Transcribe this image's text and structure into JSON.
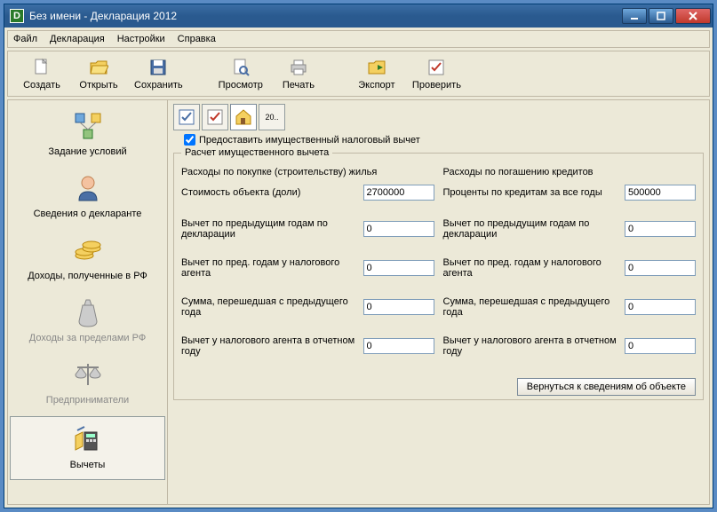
{
  "window": {
    "title": "Без имени - Декларация 2012",
    "app_icon_letter": "D"
  },
  "menu": {
    "file": "Файл",
    "declaration": "Декларация",
    "settings": "Настройки",
    "help": "Справка"
  },
  "toolbar": {
    "create": "Создать",
    "open": "Открыть",
    "save": "Сохранить",
    "preview": "Просмотр",
    "print": "Печать",
    "export": "Экспорт",
    "check": "Проверить"
  },
  "sidebar": {
    "items": [
      {
        "label": "Задание условий"
      },
      {
        "label": "Сведения о декларанте"
      },
      {
        "label": "Доходы, полученные в РФ"
      },
      {
        "label": "Доходы за пределами РФ"
      },
      {
        "label": "Предприниматели"
      },
      {
        "label": "Вычеты"
      }
    ]
  },
  "content": {
    "mini_toolbar_badge": "20..",
    "checkbox_label": "Предоставить имущественный налоговый вычет",
    "checkbox_checked": true,
    "section_legend": "Расчет имущественного вычета",
    "left_col_title": "Расходы по покупке (строительству) жилья",
    "right_col_title": "Расходы по погашению кредитов",
    "left_fields": [
      {
        "label": "Стоимость объекта (доли)",
        "value": "2700000"
      },
      {
        "label": "Вычет по предыдущим годам по декларации",
        "value": "0"
      },
      {
        "label": "Вычет по пред. годам у налогового агента",
        "value": "0"
      },
      {
        "label": "Сумма, перешедшая с предыдущего года",
        "value": "0"
      },
      {
        "label": "Вычет у налогового агента в отчетном году",
        "value": "0"
      }
    ],
    "right_fields": [
      {
        "label": "Проценты по кредитам за все годы",
        "value": "500000"
      },
      {
        "label": "Вычет по предыдущим годам по декларации",
        "value": "0"
      },
      {
        "label": "Вычет по пред. годам у налогового агента",
        "value": "0"
      },
      {
        "label": "Сумма, перешедшая с предыдущего года",
        "value": "0"
      },
      {
        "label": "Вычет у налогового агента в отчетном году",
        "value": "0"
      }
    ],
    "return_button": "Вернуться к сведениям об объекте"
  }
}
